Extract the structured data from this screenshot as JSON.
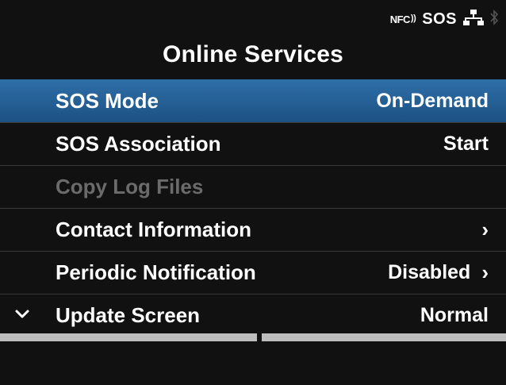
{
  "status": {
    "nfc_label": "NFC",
    "nfc_waves": "))",
    "sos_label": "SOS",
    "network_icon": "network-icon",
    "bluetooth_icon": "bluetooth-icon"
  },
  "title": "Online Services",
  "menu": [
    {
      "label": "SOS Mode",
      "value": "On-Demand",
      "chevron": "",
      "selected": true,
      "disabled": false
    },
    {
      "label": "SOS Association",
      "value": "Start",
      "chevron": "",
      "selected": false,
      "disabled": false
    },
    {
      "label": "Copy Log Files",
      "value": "",
      "chevron": "",
      "selected": false,
      "disabled": true
    },
    {
      "label": "Contact Information",
      "value": "",
      "chevron": "›",
      "selected": false,
      "disabled": false
    },
    {
      "label": "Periodic Notification",
      "value": "Disabled",
      "chevron": "›",
      "selected": false,
      "disabled": false
    },
    {
      "label": "Update Screen",
      "value": "Normal",
      "chevron": "",
      "selected": false,
      "disabled": false
    }
  ],
  "colors": {
    "selected_row": "#1c5183",
    "disabled_text": "#6b6b6b",
    "softkey_strip": "#bdbdbd"
  }
}
